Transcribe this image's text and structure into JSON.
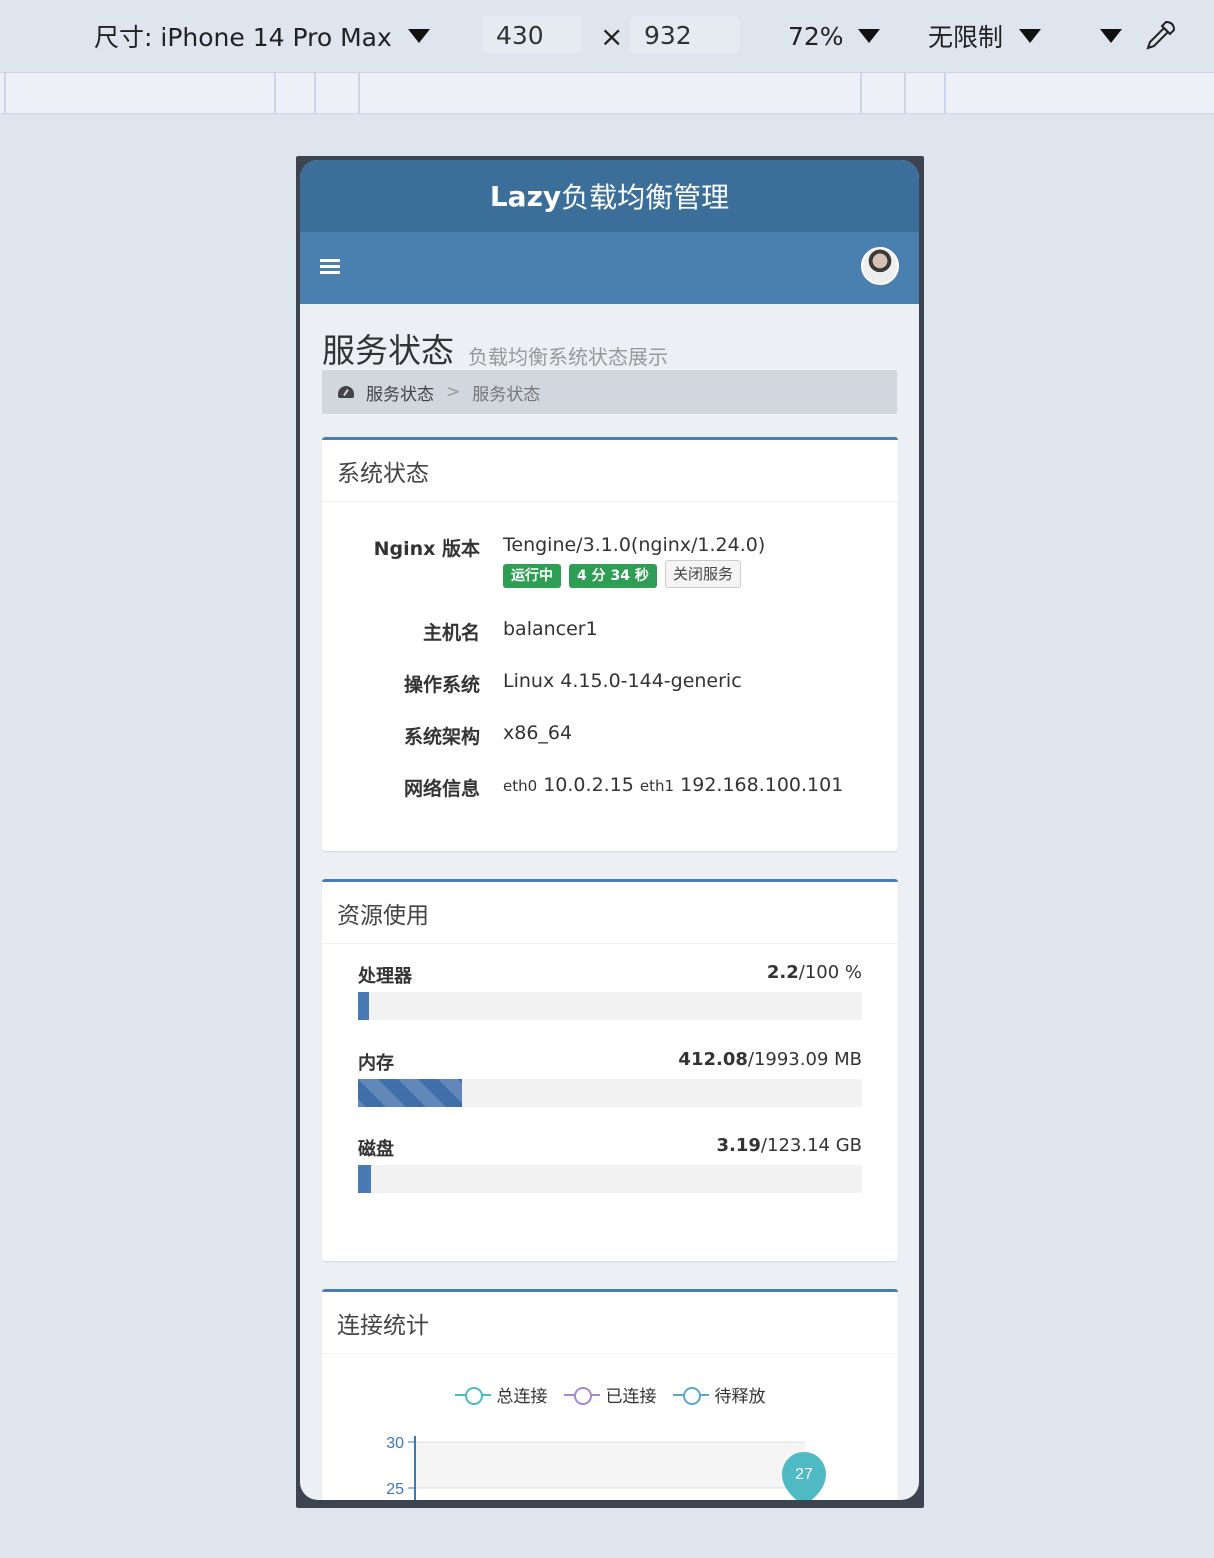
{
  "devtools": {
    "device_label": "尺寸: iPhone 14 Pro Max",
    "width": "430",
    "times": "×",
    "height": "932",
    "zoom": "72%",
    "throttle": "无限制"
  },
  "app": {
    "brand_bold": "Lazy",
    "brand_rest": "负载均衡管理"
  },
  "page": {
    "title": "服务状态",
    "subtitle": "负载均衡系统状态展示",
    "breadcrumb": [
      "服务状态",
      ">",
      "服务状态"
    ]
  },
  "system_status": {
    "title": "系统状态",
    "rows": [
      {
        "label": "Nginx 版本",
        "value": "Tengine/3.1.0(nginx/1.24.0)"
      },
      {
        "label": "主机名",
        "value": "balancer1"
      },
      {
        "label": "操作系统",
        "value": "Linux 4.15.0-144-generic"
      },
      {
        "label": "系统架构",
        "value": "x86_64"
      },
      {
        "label": "网络信息",
        "value": ""
      }
    ],
    "badges": {
      "running": "运行中",
      "uptime": "4 分 34 秒",
      "stop": "关闭服务"
    },
    "network": {
      "if1": "eth0",
      "ip1": "10.0.2.15",
      "if2": "eth1",
      "ip2": "192.168.100.101"
    }
  },
  "resources": {
    "title": "资源使用",
    "items": [
      {
        "name": "处理器",
        "used": "2.2",
        "total": "/100 %",
        "fraction": 0.022
      },
      {
        "name": "内存",
        "used": "412.08",
        "total": "/1993.09 MB",
        "fraction": 0.207
      },
      {
        "name": "磁盘",
        "used": "3.19",
        "total": "/123.14 GB",
        "fraction": 0.026
      }
    ]
  },
  "connections": {
    "title": "连接统计",
    "legend": [
      "总连接",
      "已连接",
      "待释放"
    ],
    "colors": {
      "total": "#4fb9c4",
      "connected": "#a48ad4",
      "pending": "#5aa6d6"
    }
  },
  "chart_data": {
    "type": "line",
    "series": [
      {
        "name": "总连接",
        "values": [
          27
        ]
      },
      {
        "name": "已连接",
        "values": []
      },
      {
        "name": "待释放",
        "values": []
      }
    ],
    "yticks": [
      "30",
      "25"
    ],
    "max_label": "27"
  }
}
